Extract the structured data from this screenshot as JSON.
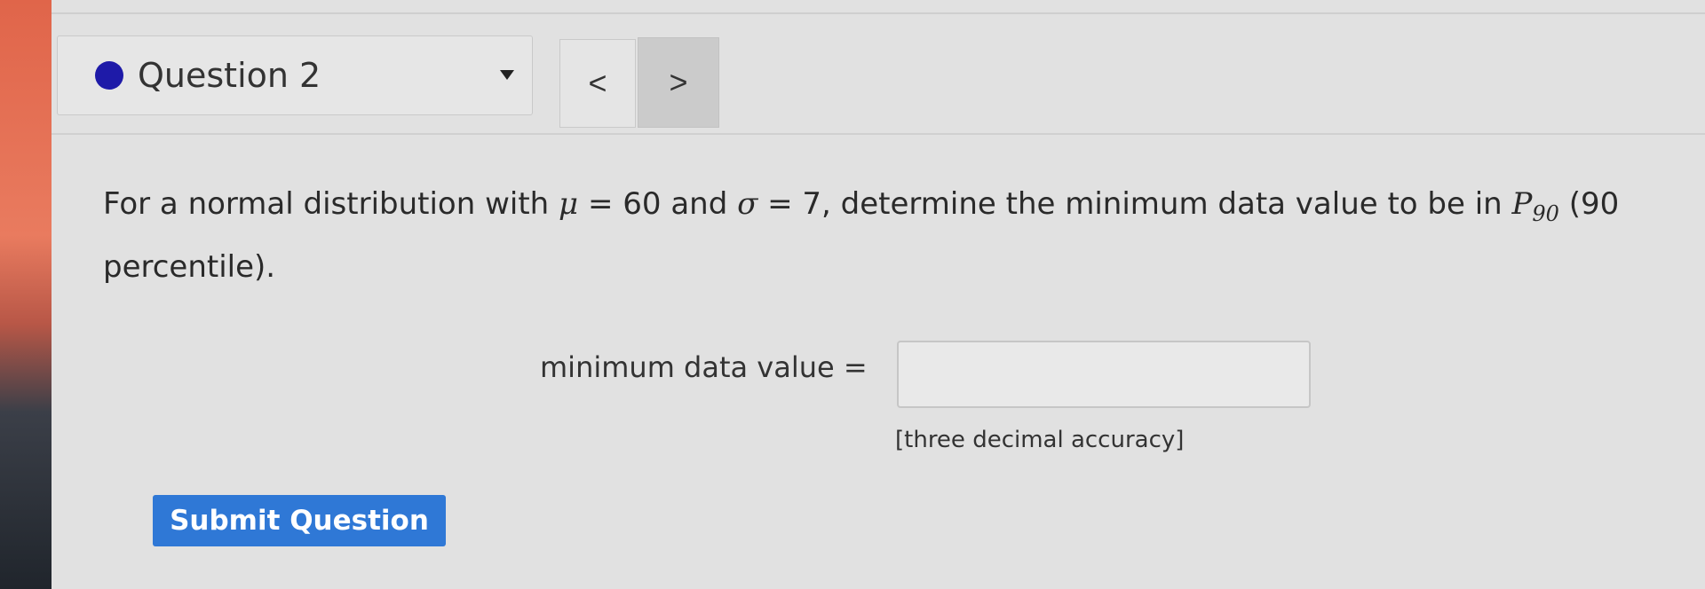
{
  "question_nav": {
    "current_question": "Question 2",
    "prev_label": "<",
    "next_label": ">",
    "status_color": "#1e1aa8"
  },
  "question": {
    "prefix": "For a normal distribution with ",
    "mu_symbol": "μ",
    "mu_part": " = 60 and ",
    "sigma_symbol": "σ",
    "sigma_part": " = 7, determine the minimum data value to be in ",
    "p_symbol": "P",
    "p_sub": "90",
    "suffix": " (90 percentile)."
  },
  "answer": {
    "label": "minimum data value =",
    "value": "",
    "placeholder": "",
    "note": "[three decimal accuracy]"
  },
  "submit": {
    "label": "Submit Question",
    "color": "#2f78d6"
  }
}
